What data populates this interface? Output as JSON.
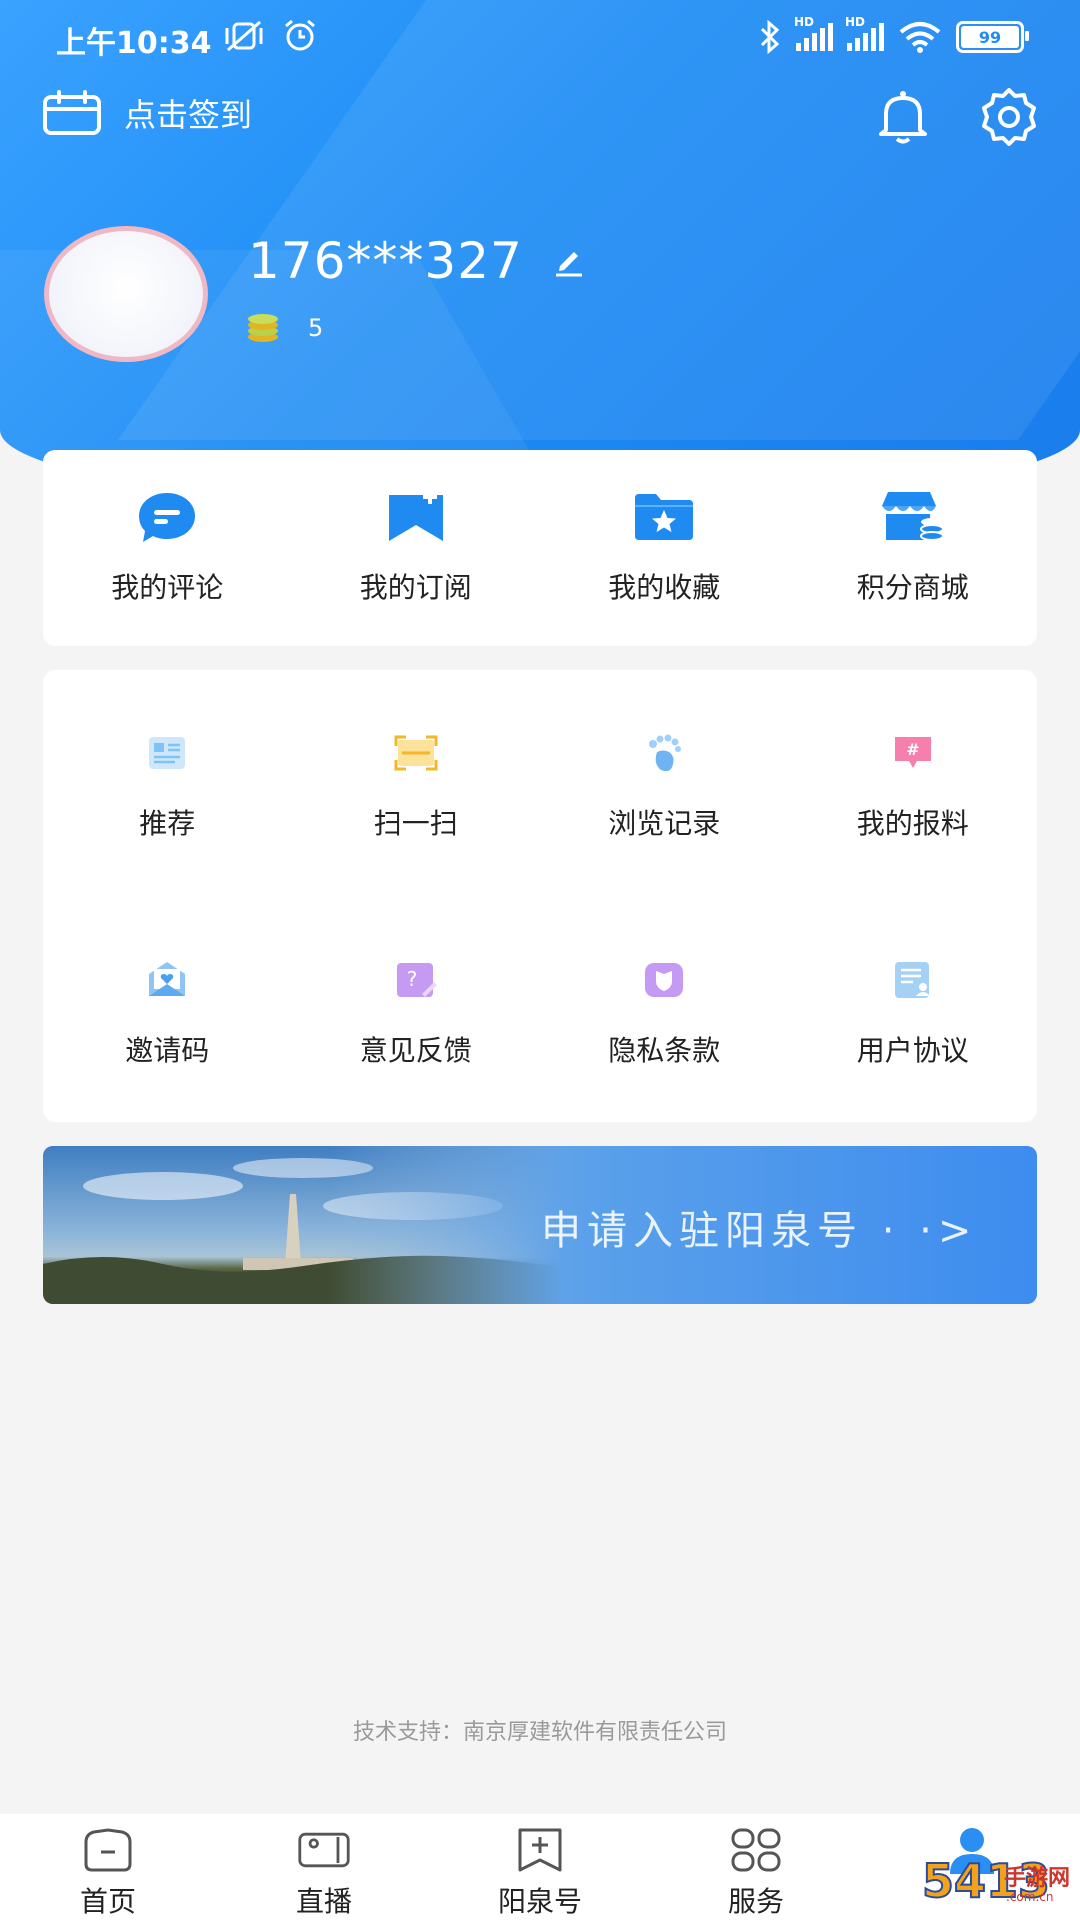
{
  "status_bar": {
    "time": "上午10:34",
    "battery": "99",
    "hd1": "HD",
    "hd2": "HD"
  },
  "header": {
    "checkin_label": "点击签到"
  },
  "profile": {
    "username": "176***327",
    "points": "5"
  },
  "quick_actions": [
    {
      "label": "我的评论",
      "icon": "comment-icon"
    },
    {
      "label": "我的订阅",
      "icon": "subscribe-icon"
    },
    {
      "label": "我的收藏",
      "icon": "favorite-folder-icon"
    },
    {
      "label": "积分商城",
      "icon": "points-store-icon"
    }
  ],
  "services": [
    {
      "label": "推荐",
      "icon": "recommend-icon"
    },
    {
      "label": "扫一扫",
      "icon": "scan-icon"
    },
    {
      "label": "浏览记录",
      "icon": "footprint-icon"
    },
    {
      "label": "我的报料",
      "icon": "report-icon"
    },
    {
      "label": "邀请码",
      "icon": "invite-code-icon"
    },
    {
      "label": "意见反馈",
      "icon": "feedback-icon"
    },
    {
      "label": "隐私条款",
      "icon": "privacy-icon"
    },
    {
      "label": "用户协议",
      "icon": "user-agreement-icon"
    }
  ],
  "banner": {
    "text": "申请入驻阳泉号 · ·>"
  },
  "footer": {
    "support": "技术支持：南京厚建软件有限责任公司"
  },
  "tabbar": [
    {
      "label": "首页",
      "icon": "home-icon"
    },
    {
      "label": "直播",
      "icon": "live-camera-icon"
    },
    {
      "label": "阳泉号",
      "icon": "yangquan-hao-icon"
    },
    {
      "label": "服务",
      "icon": "services-grid-icon"
    },
    {
      "label": "",
      "icon": "profile-icon",
      "active": true
    }
  ],
  "watermark": {
    "digits": "5413",
    "cn": "手游网",
    "url": ".com.cn"
  },
  "colors": {
    "brand_blue": "#1d8cf5",
    "active_tab": "#2a8ef2"
  }
}
